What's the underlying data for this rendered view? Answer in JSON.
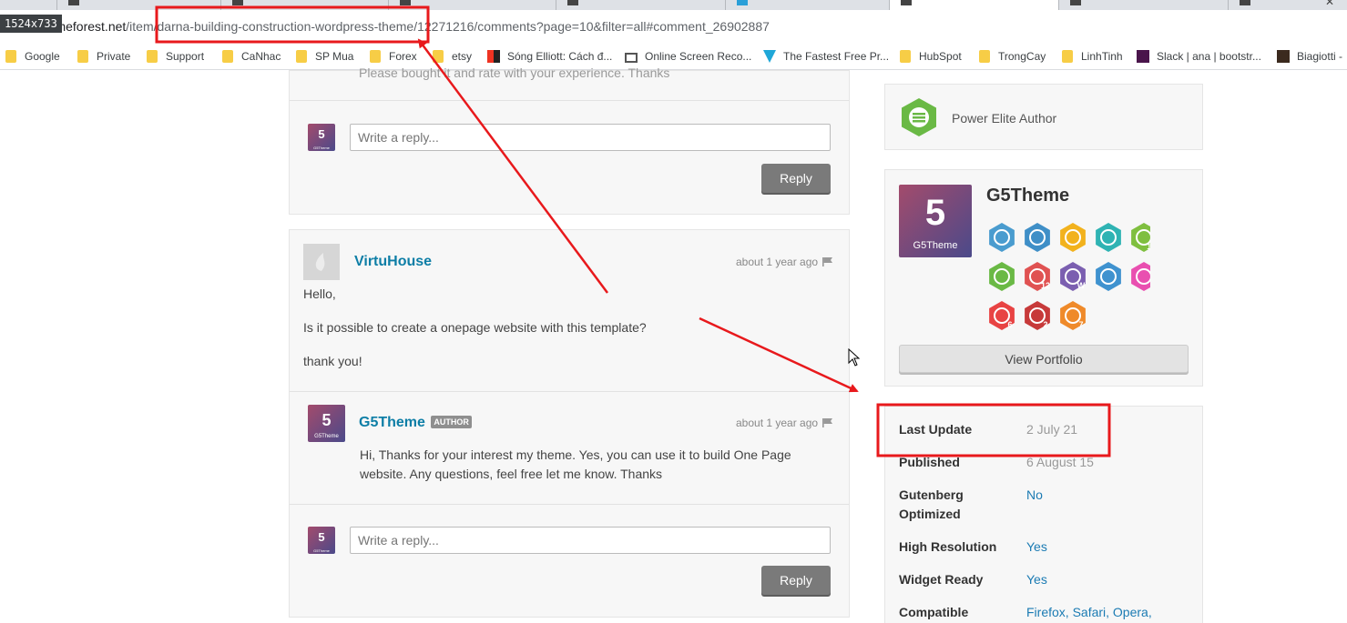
{
  "screenshot_size_badge": "1524x733",
  "url": {
    "host": "themeforest.net",
    "path": "/item/darna-building-construction-wordpress-theme/12271216/comments?page=10&filter=all#comment_26902887"
  },
  "bookmarks": [
    "Google",
    "Private",
    "Support",
    "CaNhac",
    "SP Mua",
    "Forex",
    "etsy",
    "Sóng Elliott: Cách đ...",
    "Online Screen Reco...",
    "The Fastest Free Pr...",
    "HubSpot",
    "TrongCay",
    "LinhTinh",
    "Slack | ana | bootstr...",
    "Biagiotti -"
  ],
  "comments": {
    "prev_text": "Please bought it and rate with your experience. Thanks",
    "reply_placeholder": "Write a reply...",
    "reply_label": "Reply",
    "thread": {
      "user": "VirtuHouse",
      "time": "about 1 year ago",
      "lines": [
        "Hello,",
        "Is it possible to create a onepage website with this template?",
        "thank you!"
      ],
      "reply": {
        "user": "G5Theme",
        "badge": "AUTHOR",
        "time": "about 1 year ago",
        "text": "Hi, Thanks for your interest my theme. Yes, you can use it to build One Page website. Any questions, feel free let me know. Thanks"
      }
    }
  },
  "avatar": {
    "glyph": "5",
    "caption": "G5Theme"
  },
  "sidebar": {
    "power_elite": "Power Elite Author",
    "author_name": "G5Theme",
    "view_portfolio": "View Portfolio",
    "badges": [
      {
        "name": "author-level-badge",
        "color": "#4a9ccf",
        "label": ""
      },
      {
        "name": "exclusive-author-badge",
        "color": "#3f8fc7",
        "label": ""
      },
      {
        "name": "support-badge",
        "color": "#f2b21d",
        "label": ""
      },
      {
        "name": "featured-badge",
        "color": "#2fb3b3",
        "label": ""
      },
      {
        "name": "sales-badge",
        "color": "#7fbf3f",
        "label": "1B"
      },
      {
        "name": "power-elite-badge",
        "color": "#6ab945",
        "label": ""
      },
      {
        "name": "referral-badge",
        "color": "#e05252",
        "label": "12"
      },
      {
        "name": "weekly-top-seller-badge",
        "color": "#7b5fb0",
        "label": "W"
      },
      {
        "name": "fast-badge",
        "color": "#3f92cf",
        "label": ""
      },
      {
        "name": "gem-badge",
        "color": "#e94fb0",
        "label": ""
      },
      {
        "name": "collector-badge",
        "color": "#e84343",
        "label": "6"
      },
      {
        "name": "community-badge",
        "color": "#c73a3a",
        "label": "2"
      },
      {
        "name": "years-badge",
        "color": "#ef8a2a",
        "label": "7"
      }
    ],
    "meta": [
      {
        "label": "Last Update",
        "value": "2 July 21",
        "style": "grey"
      },
      {
        "label": "Published",
        "value": "6 August 15",
        "style": "grey"
      },
      {
        "label": "Gutenberg Optimized",
        "value": "No",
        "style": "link"
      },
      {
        "label": "High Resolution",
        "value": "Yes",
        "style": "link"
      },
      {
        "label": "Widget Ready",
        "value": "Yes",
        "style": "link"
      },
      {
        "label": "Compatible",
        "value": "Firefox, Safari, Opera,",
        "style": "link"
      }
    ]
  },
  "colors": {
    "annotation_red": "#e8191c",
    "link_blue": "#0d7ea6"
  }
}
